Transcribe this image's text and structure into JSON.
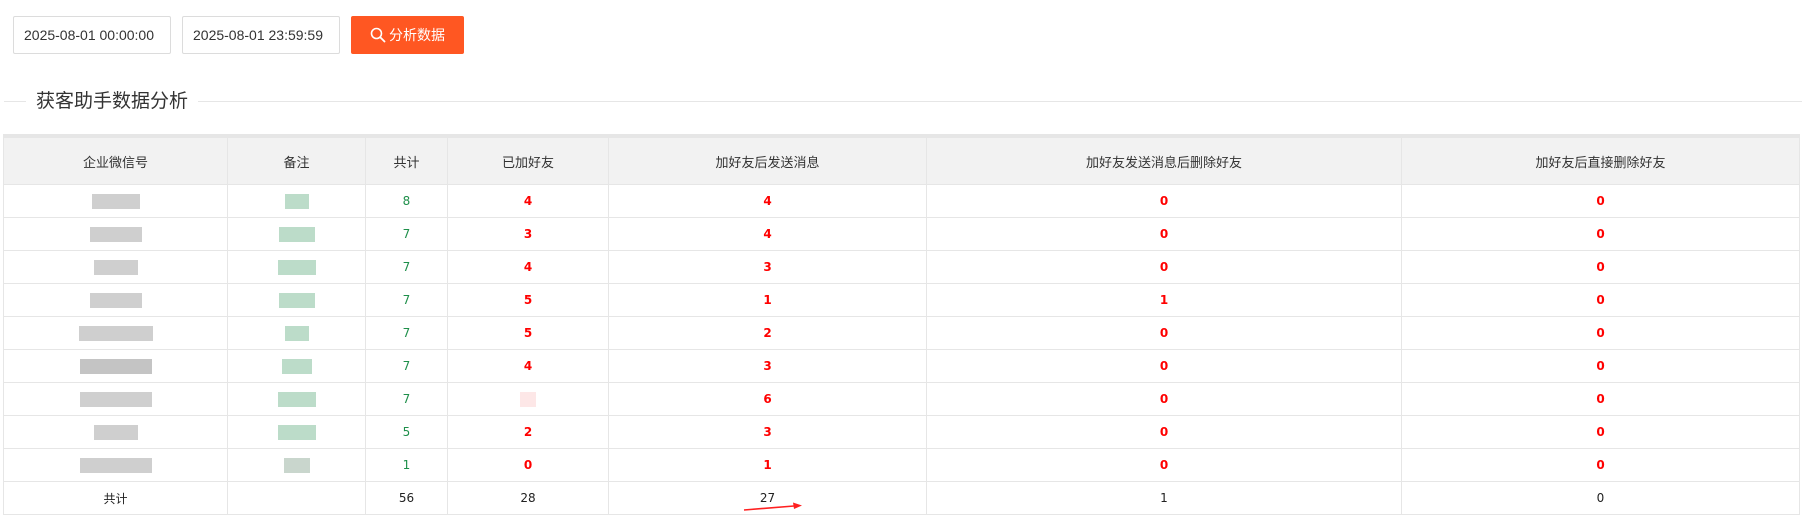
{
  "filters": {
    "start_time": "2025-08-01 00:00:00",
    "end_time": "2025-08-01 23:59:59",
    "analyze_button_label": "分析数据"
  },
  "section": {
    "title": "获客助手数据分析"
  },
  "table": {
    "headers": {
      "account": "企业微信号",
      "remark": "备注",
      "total": "共计",
      "added_friends": "已加好友",
      "msg_after_add": "加好友后发送消息",
      "delete_after_msg": "加好友发送消息后删除好友",
      "delete_direct": "加好友后直接删除好友"
    },
    "rows": [
      {
        "total": "8",
        "added_friends": "4",
        "msg_after_add": "4",
        "delete_after_msg": "0",
        "delete_direct": "0"
      },
      {
        "total": "7",
        "added_friends": "3",
        "msg_after_add": "4",
        "delete_after_msg": "0",
        "delete_direct": "0"
      },
      {
        "total": "7",
        "added_friends": "4",
        "msg_after_add": "3",
        "delete_after_msg": "0",
        "delete_direct": "0"
      },
      {
        "total": "7",
        "added_friends": "5",
        "msg_after_add": "1",
        "delete_after_msg": "1",
        "delete_direct": "0"
      },
      {
        "total": "7",
        "added_friends": "5",
        "msg_after_add": "2",
        "delete_after_msg": "0",
        "delete_direct": "0"
      },
      {
        "total": "7",
        "added_friends": "4",
        "msg_after_add": "3",
        "delete_after_msg": "0",
        "delete_direct": "0"
      },
      {
        "total": "7",
        "added_friends": "",
        "msg_after_add": "6",
        "delete_after_msg": "0",
        "delete_direct": "0"
      },
      {
        "total": "5",
        "added_friends": "2",
        "msg_after_add": "3",
        "delete_after_msg": "0",
        "delete_direct": "0"
      },
      {
        "total": "1",
        "added_friends": "0",
        "msg_after_add": "1",
        "delete_after_msg": "0",
        "delete_direct": "0"
      }
    ],
    "totals": {
      "label": "共计",
      "total": "56",
      "added_friends": "28",
      "msg_after_add": "27",
      "delete_after_msg": "1",
      "delete_direct": "0"
    }
  },
  "colors": {
    "accent": "#ff5722",
    "highlight_red": "#ff0000",
    "total_green": "#1e8f4a"
  },
  "icons": {
    "analyze_button": "search-icon",
    "annotation": "arrow-right-icon"
  }
}
